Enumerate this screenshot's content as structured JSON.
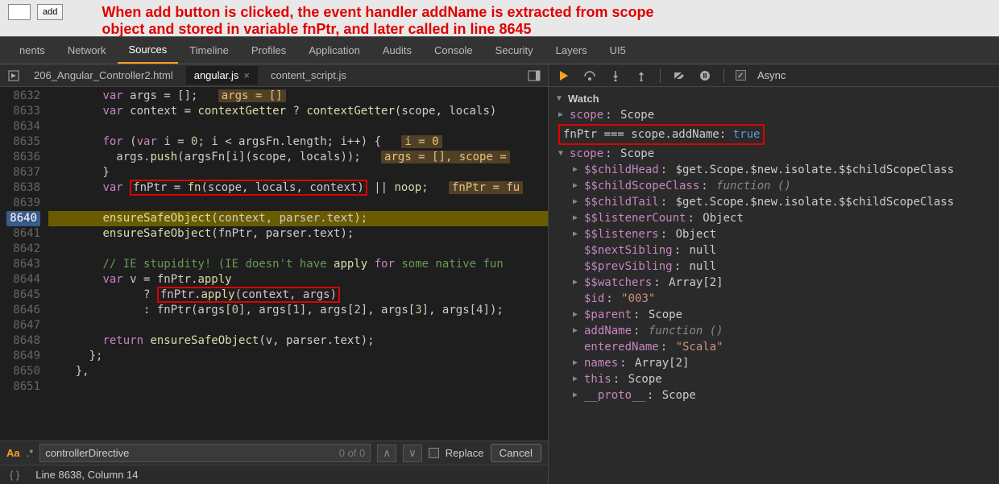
{
  "top": {
    "add_label": "add",
    "annotation_line1": "When add button is clicked, the event handler addName is extracted from scope",
    "annotation_line2": "object and stored in variable fnPtr, and later called in line 8645"
  },
  "tabs": [
    "nents",
    "Network",
    "Sources",
    "Timeline",
    "Profiles",
    "Application",
    "Audits",
    "Console",
    "Security",
    "Layers",
    "UI5"
  ],
  "active_tab": "Sources",
  "files": {
    "file1": "206_Angular_Controller2.html",
    "file2": "angular.js",
    "file3": "content_script.js"
  },
  "active_file": "angular.js",
  "gutter": [
    "8632",
    "8633",
    "8634",
    "8635",
    "8636",
    "8637",
    "8638",
    "8639",
    "8640",
    "8641",
    "8642",
    "8643",
    "8644",
    "8645",
    "8646",
    "8647",
    "8648",
    "8649",
    "8650",
    "8651"
  ],
  "breakpoint_line": "8640",
  "code": {
    "l8632": {
      "pre": "        var args = [];",
      "hint": "args = []"
    },
    "l8633": "        var context = contextGetter ? contextGetter(scope, locals)",
    "l8634": "",
    "l8635": {
      "pre": "        for (var i = 0; i < argsFn.length; i++) {",
      "hint": "i = 0"
    },
    "l8636": {
      "pre": "          args.push(argsFn[i](scope, locals));",
      "hint": "args = [], scope ="
    },
    "l8637": "        }",
    "l8638": {
      "pre": "        var ",
      "box": "fnPtr = fn(scope, locals, context)",
      "post": " || noop;",
      "hint": "fnPtr = fu"
    },
    "l8639": "",
    "l8640": "        ensureSafeObject(context, parser.text);",
    "l8641": "        ensureSafeObject(fnPtr, parser.text);",
    "l8642": "",
    "l8643": "        // IE stupidity! (IE doesn't have apply for some native fun",
    "l8644": "        var v = fnPtr.apply",
    "l8645": {
      "pre": "              ? ",
      "box": "fnPtr.apply(context, args)"
    },
    "l8646": "              : fnPtr(args[0], args[1], args[2], args[3], args[4]);",
    "l8647": "",
    "l8648": "        return ensureSafeObject(v, parser.text);",
    "l8649": "      };",
    "l8650": "    },",
    "l8651": ""
  },
  "search": {
    "query": "controllerDirective",
    "count": "0 of 0",
    "replace_label": "Replace",
    "cancel_label": "Cancel"
  },
  "status": {
    "line_col": "Line 8638, Column 14"
  },
  "watch": {
    "title": "Watch",
    "async_label": "Async",
    "scope1": {
      "k": "scope",
      "v": "Scope"
    },
    "red": {
      "expr": "fnPtr === scope.addName",
      "val": "true"
    },
    "scope2": {
      "k": "scope",
      "v": "Scope"
    },
    "props": [
      {
        "k": "$$childHead",
        "v": "$get.Scope.$new.isolate.$$childScopeClass",
        "ar": true
      },
      {
        "k": "$$childScopeClass",
        "v": "function ()",
        "fn": true,
        "ar": true
      },
      {
        "k": "$$childTail",
        "v": "$get.Scope.$new.isolate.$$childScopeClass",
        "ar": true
      },
      {
        "k": "$$listenerCount",
        "v": "Object",
        "ar": true
      },
      {
        "k": "$$listeners",
        "v": "Object",
        "ar": true
      },
      {
        "k": "$$nextSibling",
        "v": "null",
        "ar": false
      },
      {
        "k": "$$prevSibling",
        "v": "null",
        "ar": false
      },
      {
        "k": "$$watchers",
        "v": "Array[2]",
        "ar": true
      },
      {
        "k": "$id",
        "v": "\"003\"",
        "str": true,
        "ar": false
      },
      {
        "k": "$parent",
        "v": "Scope",
        "ar": true
      },
      {
        "k": "addName",
        "v": "function ()",
        "fn": true,
        "ar": true
      },
      {
        "k": "enteredName",
        "v": "\"Scala\"",
        "str": true,
        "ar": false
      },
      {
        "k": "names",
        "v": "Array[2]",
        "ar": true
      },
      {
        "k": "this",
        "v": "Scope",
        "ar": true
      },
      {
        "k": "__proto__",
        "v": "Scope",
        "ar": true
      }
    ]
  }
}
